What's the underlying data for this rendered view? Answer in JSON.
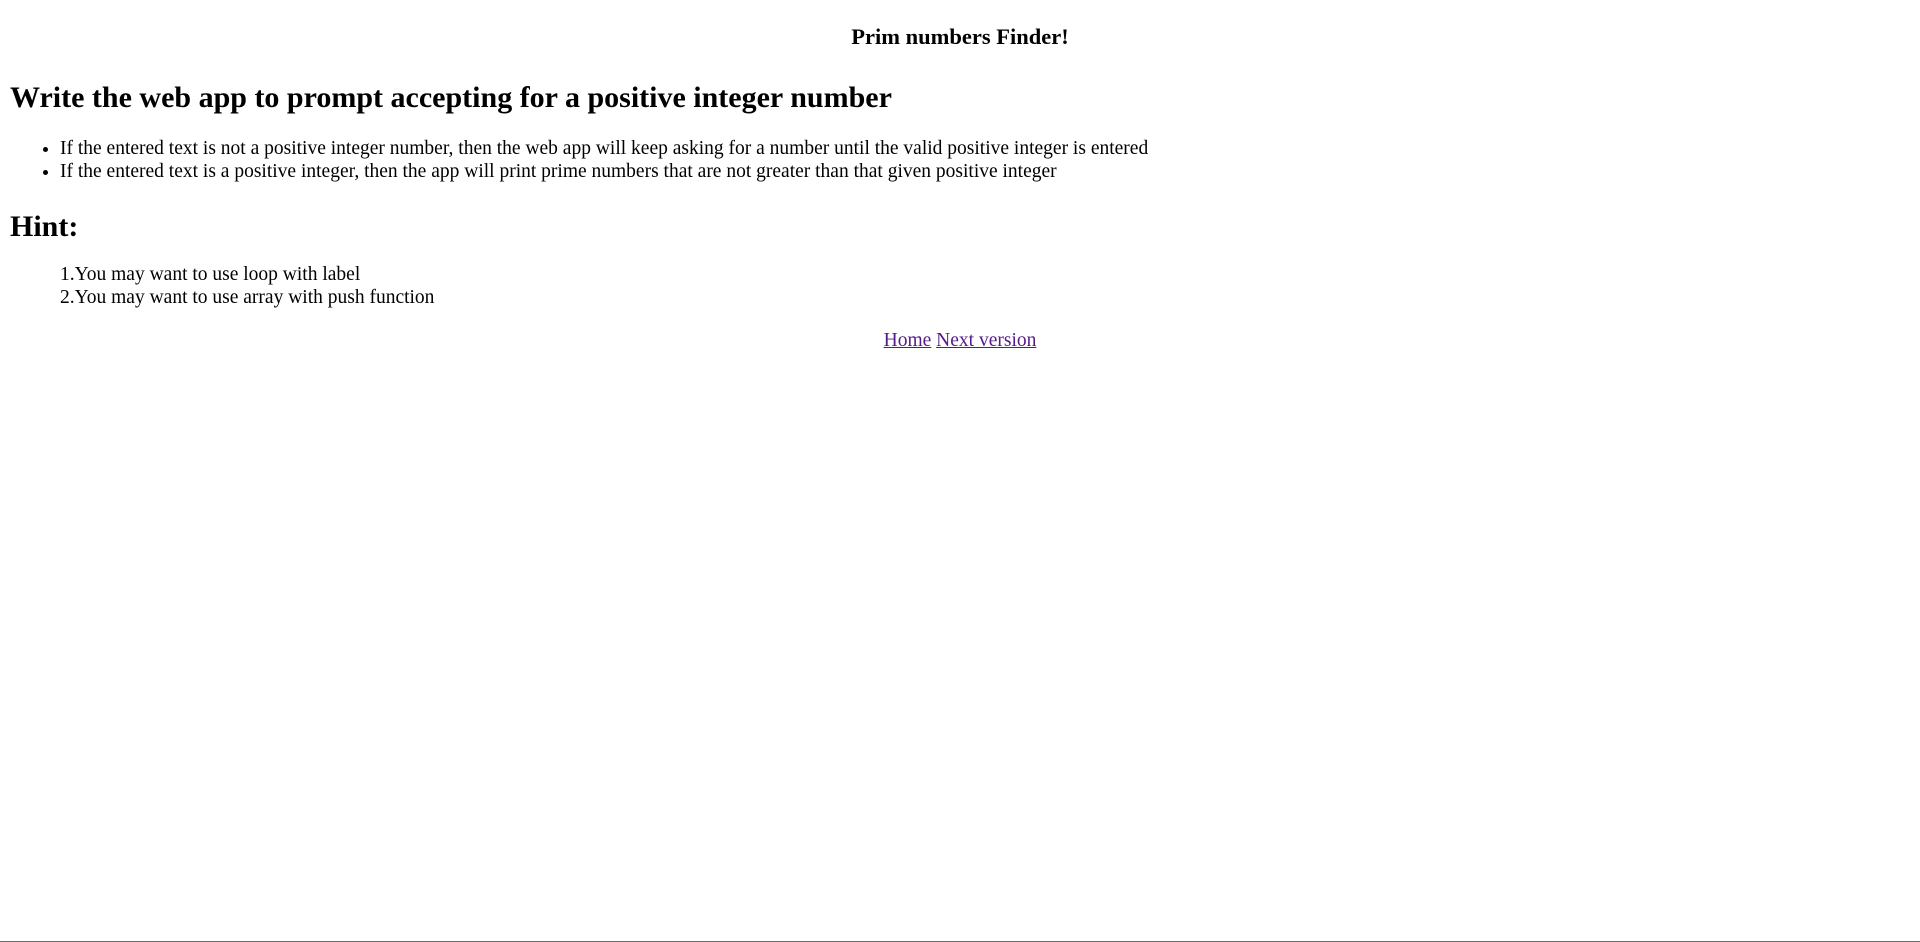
{
  "page_heading": "Prim numbers Finder!",
  "task": {
    "title": "Write the web app to prompt accepting for a positive integer number",
    "requirements": [
      "If the entered text is not a positive integer number, then the web app will keep asking for a number until the valid positive integer is entered",
      "If the entered text is a positive integer, then the app will print prime numbers that are not greater than that given positive integer"
    ]
  },
  "hint": {
    "title": "Hint:",
    "items": [
      "1.You may want to use loop with label",
      "2.You may want to use array with push function"
    ]
  },
  "nav": {
    "home_label": "Home",
    "next_label": "Next version"
  },
  "colors": {
    "visited_link": "#551a8b",
    "text": "#000000",
    "background": "#ffffff"
  }
}
